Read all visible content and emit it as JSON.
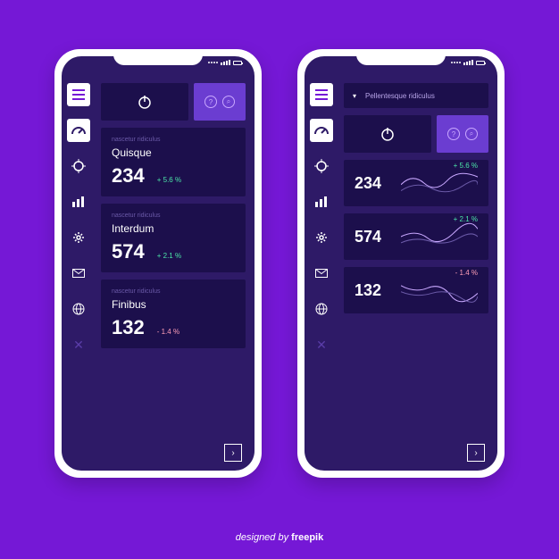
{
  "footer": {
    "prefix": "designed by ",
    "brand": "freepik"
  },
  "phone1": {
    "power_icon": "power",
    "help_icons": [
      "help",
      "search"
    ],
    "cards": [
      {
        "subtitle": "nascetur ridiculus",
        "title": "Quisque",
        "value": "234",
        "delta": "+ 5.6 %",
        "direction": "up"
      },
      {
        "subtitle": "nascetur ridiculus",
        "title": "Interdum",
        "value": "574",
        "delta": "+ 2.1 %",
        "direction": "up"
      },
      {
        "subtitle": "nascetur ridiculus",
        "title": "Finibus",
        "value": "132",
        "delta": "- 1.4 %",
        "direction": "down"
      }
    ]
  },
  "phone2": {
    "dropdown_label": "Pellentesque ridiculus",
    "power_icon": "power",
    "help_icons": [
      "help",
      "search"
    ],
    "cards": [
      {
        "value": "234",
        "delta": "+ 5.6 %",
        "direction": "up"
      },
      {
        "value": "574",
        "delta": "+ 2.1 %",
        "direction": "up"
      },
      {
        "value": "132",
        "delta": "- 1.4 %",
        "direction": "down"
      }
    ]
  },
  "sidebar_icons": [
    "menu",
    "gauge",
    "target",
    "bars",
    "gear",
    "mail",
    "globe",
    "close"
  ]
}
